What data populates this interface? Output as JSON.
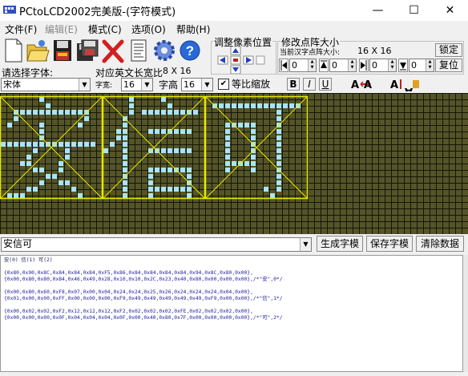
{
  "window": {
    "title": "PCtoLCD2002完美版-(字符模式)",
    "controls": [
      "—",
      "☐",
      "✕"
    ]
  },
  "menu": [
    "文件(F)",
    "编辑(E)",
    "模式(C)",
    "选项(O)",
    "帮助(H)"
  ],
  "toolbar": {
    "icons": [
      "new-file-icon",
      "open-folder-icon",
      "save-disk-icon",
      "export-disk-icon",
      "delete-x-icon",
      "document-icon",
      "settings-gear-icon",
      "help-icon"
    ]
  },
  "pixel_adjust": {
    "title": "调整像素位置"
  },
  "dot_size": {
    "title": "修改点阵大小",
    "current_label": "当前汉字点阵大小:",
    "current_value": "16  X  16",
    "lock_button": "锁定",
    "reset_button": "复位",
    "spin_values": [
      "0",
      "0",
      "0",
      "0"
    ]
  },
  "font": {
    "select_label": "请选择字体:",
    "font_name": "宋体",
    "english_width_label": "对应英文长宽比",
    "english_width_value": "8 X 16",
    "width_label": "字宽:",
    "width_value": "16",
    "height_label": "字高",
    "height_value": "16",
    "scale_label": "等比缩放",
    "scale_checked": "✔"
  },
  "format_buttons": [
    "B",
    "I",
    "U"
  ],
  "bottom": {
    "input_text": "安信可",
    "generate_button": "生成字模",
    "save_button": "保存字模",
    "clear_button": "清除数据"
  },
  "output": {
    "index_line": "安(0) 信(1) 可(2)",
    "lines": [
      "{0x80,0x90,0x8C,0x84,0x84,0x84,0xF5,0x86,0x84,0x84,0x84,0x84,0x94,0x8C,0x80,0x00},",
      "{0x00,0x80,0x80,0x84,0x46,0x49,0x28,0x10,0x10,0x2C,0x23,0x40,0x80,0x00,0x00,0x00},/*\"安\",0*/",
      "",
      "{0x00,0x80,0x60,0xF8,0x07,0x00,0x04,0x24,0x24,0x25,0x26,0x24,0x24,0x24,0x04,0x00},",
      "{0x01,0x00,0x00,0xFF,0x00,0x00,0x00,0xF9,0x49,0x49,0x49,0x49,0x49,0xF9,0x00,0x00},/*\"信\",1*/",
      "",
      "{0x00,0x02,0x02,0xF2,0x12,0x12,0x12,0xF2,0x02,0x02,0x02,0xFE,0x02,0x02,0x02,0x00},",
      "{0x00,0x00,0x00,0x0F,0x04,0x04,0x04,0x0F,0x00,0x40,0x80,0x7F,0x00,0x00,0x00,0x00},/*\"可\",2*/"
    ]
  },
  "colors": {
    "lcd_background": "#545428",
    "lcd_pixel_on": "#a8e4ff",
    "glyph_frame": "#e8e800"
  }
}
